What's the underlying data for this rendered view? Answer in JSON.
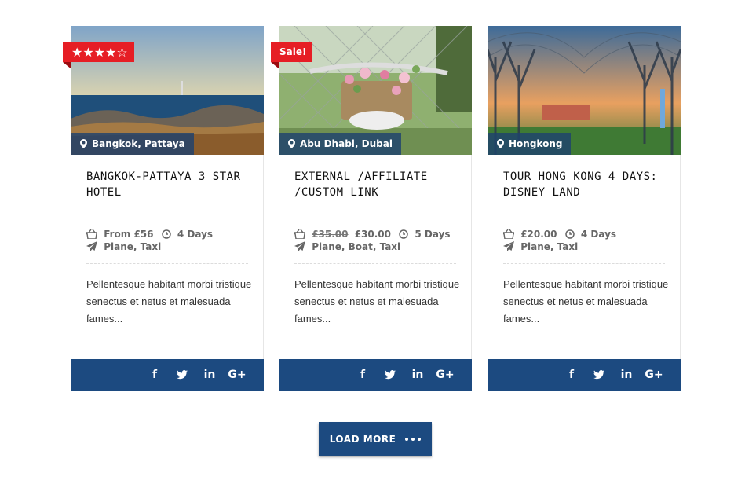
{
  "colors": {
    "brand": "#1c4a80",
    "badge": "#e61e25",
    "text": "#333333"
  },
  "tours": [
    {
      "badge": "★★★★☆",
      "badge_type": "rating",
      "rating": 4,
      "location": "Bangkok, Pattaya",
      "title": "Bangkok-Pattaya 3 Star Hotel",
      "price_old": "",
      "price": "From £56",
      "duration": "4 Days",
      "transport": "Plane, Taxi",
      "excerpt": "Pellentesque habitant morbi tristique senectus et netus et malesuada fames..."
    },
    {
      "badge": "Sale!",
      "badge_type": "sale",
      "location": "Abu Dhabi, Dubai",
      "title": "External /Affiliate /Custom Link",
      "price_old": "£35.00",
      "price": "£30.00",
      "duration": "5 Days",
      "transport": "Plane, Boat, Taxi",
      "excerpt": "Pellentesque habitant morbi tristique senectus et netus et malesuada fames..."
    },
    {
      "badge": "",
      "badge_type": "none",
      "location": "Hongkong",
      "title": "Tour Hong Kong 4 Days: Disney Land",
      "price_old": "",
      "price": "£20.00",
      "duration": "4 Days",
      "transport": "Plane, Taxi",
      "excerpt": "Pellentesque habitant morbi tristique senectus et netus et malesuada fames..."
    }
  ],
  "social_icons": [
    "facebook-icon",
    "twitter-icon",
    "linkedin-icon",
    "google-plus-icon"
  ],
  "social_glyphs": {
    "facebook": "f",
    "linkedin": "in",
    "googleplus": "G+"
  },
  "load_more": {
    "label": "LOAD MORE"
  }
}
